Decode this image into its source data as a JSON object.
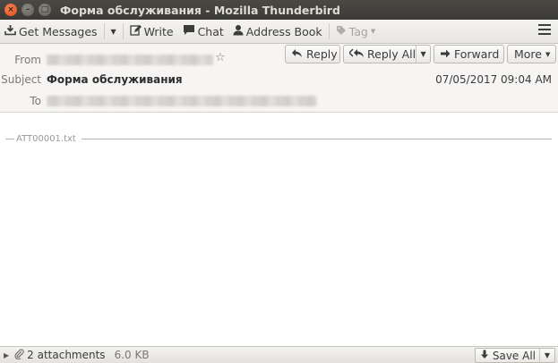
{
  "window": {
    "title": "Форма обслуживания - Mozilla Thunderbird",
    "close_glyph": "×",
    "min_glyph": "–",
    "max_glyph": "□"
  },
  "toolbar": {
    "get_messages": "Get Messages",
    "write": "Write",
    "chat": "Chat",
    "address_book": "Address Book",
    "tag": "Tag"
  },
  "icons": {
    "get_messages": "download-tray-icon",
    "write": "pencil-icon",
    "chat": "speech-bubble-icon",
    "address_book": "person-icon",
    "tag": "tag-icon",
    "menu": "hamburger-menu-icon"
  },
  "header": {
    "from_label": "From",
    "subject_label": "Subject",
    "to_label": "To",
    "subject": "Форма обслуживания",
    "date": "07/05/2017 09:04 AM",
    "reply": "Reply",
    "reply_all": "Reply All",
    "forward": "Forward",
    "more": "More"
  },
  "body": {
    "attachment_name": "ATT00001.txt"
  },
  "attachments": {
    "count_label": "2 attachments",
    "size": "6.0 KB",
    "save_all": "Save All"
  }
}
